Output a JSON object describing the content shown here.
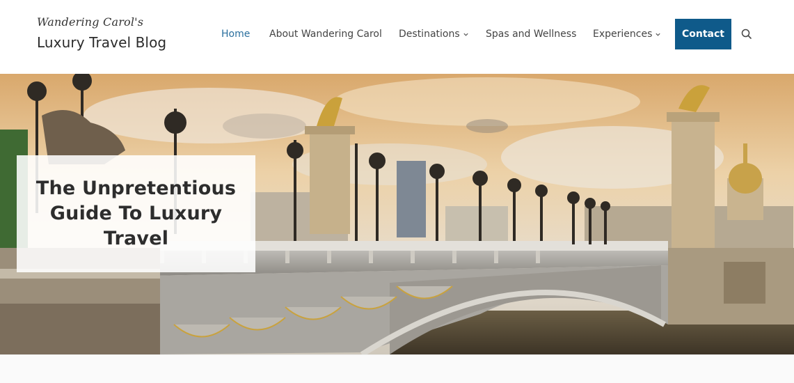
{
  "header": {
    "logo_script": "Wandering Carol's",
    "logo_main": "Luxury Travel Blog"
  },
  "nav": {
    "home": "Home",
    "about": "About Wandering Carol",
    "destinations": "Destinations",
    "spas": "Spas and Wellness",
    "experiences": "Experiences",
    "contact": "Contact"
  },
  "hero": {
    "title": "The Unpretentious Guide To Luxury Travel"
  },
  "colors": {
    "accent": "#0f5a8a",
    "active_link": "#2a6f9e",
    "text": "#444444"
  },
  "icons": {
    "search": "search-icon",
    "dropdown": "chevron-down-icon"
  }
}
